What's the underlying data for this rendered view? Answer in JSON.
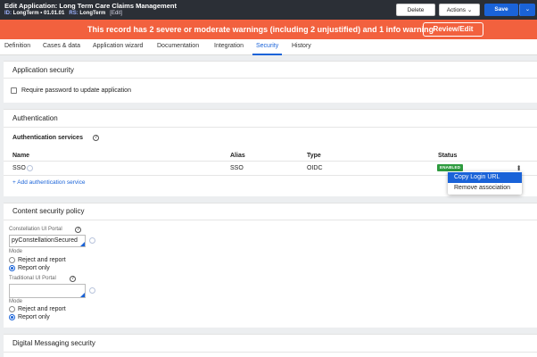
{
  "header": {
    "title": "Edit  Application: Long Term Care Claims Management",
    "id_label": "ID:",
    "id_value": "LongTerm • 01.01.01",
    "rs_label": "RS:",
    "rs_value": "LongTerm",
    "edit_link": "[Edit]",
    "delete_label": "Delete",
    "actions_label": "Actions",
    "save_label": "Save"
  },
  "warning": {
    "text": "This record has 2 severe or moderate warnings (including 2 unjustified) and 1 info warning",
    "review_label": "Review/Edit"
  },
  "tabs": [
    "Definition",
    "Cases & data",
    "Application wizard",
    "Documentation",
    "Integration",
    "Security",
    "History"
  ],
  "app_security": {
    "title": "Application security",
    "checkbox_label": "Require password to update application"
  },
  "authentication": {
    "title": "Authentication",
    "services_label": "Authentication services",
    "columns": [
      "Name",
      "Alias",
      "Type",
      "Status"
    ],
    "row": {
      "name": "SSO",
      "alias": "SSO",
      "type": "OIDC",
      "status": "ENABLED"
    },
    "add_label": "+ Add authentication service",
    "menu": [
      "Copy Login URL",
      "Remove association"
    ]
  },
  "csp": {
    "title": "Content security policy",
    "constellation_label": "Constellation UI Portal",
    "constellation_value": "pyConstellationSecured",
    "mode_label": "Mode",
    "option_reject": "Reject and report",
    "option_report": "Report only",
    "traditional_label": "Traditional UI Portal",
    "traditional_value": ""
  },
  "digital_messaging": {
    "title": "Digital Messaging security"
  },
  "colors": {
    "header_bg": "#2b2f36",
    "warning_bg": "#f2613e",
    "primary": "#1a63d8",
    "enabled": "#2e9b3f"
  }
}
